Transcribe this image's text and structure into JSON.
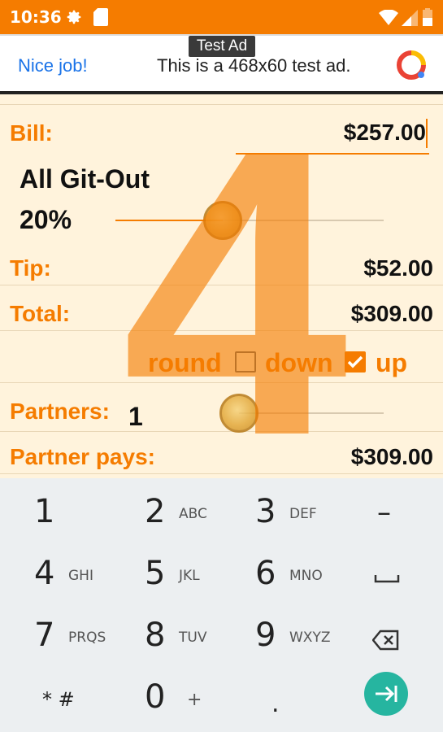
{
  "status_bar": {
    "time": "10:36",
    "icons": [
      "gear-icon",
      "sd-card-icon",
      "wifi-icon",
      "signal-icon",
      "battery-icon"
    ]
  },
  "ad": {
    "badge": "Test Ad",
    "left_text": "Nice job!",
    "text": "This is a 468x60 test ad."
  },
  "big_number": "4",
  "bill": {
    "label": "Bill:",
    "value": "$257.00"
  },
  "tip_level": {
    "name": "All Git-Out",
    "percent": "20%",
    "slider_fraction": 0.4
  },
  "tip": {
    "label": "Tip:",
    "value": "$52.00"
  },
  "total": {
    "label": "Total:",
    "value": "$309.00"
  },
  "rounding": {
    "label": "round",
    "down_label": "down",
    "up_label": "up",
    "down_checked": false,
    "up_checked": true
  },
  "partners": {
    "label": "Partners:",
    "count": "1",
    "slider_fraction": 0.0
  },
  "partner_pays": {
    "label": "Partner pays:",
    "value": "$309.00"
  },
  "keypad": {
    "keys": [
      {
        "digit": "1",
        "letters": ""
      },
      {
        "digit": "2",
        "letters": "ABC"
      },
      {
        "digit": "3",
        "letters": "DEF"
      },
      {
        "digit": "4",
        "letters": "GHI"
      },
      {
        "digit": "5",
        "letters": "JKL"
      },
      {
        "digit": "6",
        "letters": "MNO"
      },
      {
        "digit": "7",
        "letters": "PRQS"
      },
      {
        "digit": "8",
        "letters": "TUV"
      },
      {
        "digit": "9",
        "letters": "WXYZ"
      },
      {
        "digit": "0",
        "letters": "+"
      }
    ],
    "minus": "–",
    "star_hash": "* #",
    "dot": "."
  },
  "colors": {
    "accent": "#f57c00",
    "background": "#fff3dc",
    "keypad": "#eceff1",
    "go": "#26b5a0"
  }
}
